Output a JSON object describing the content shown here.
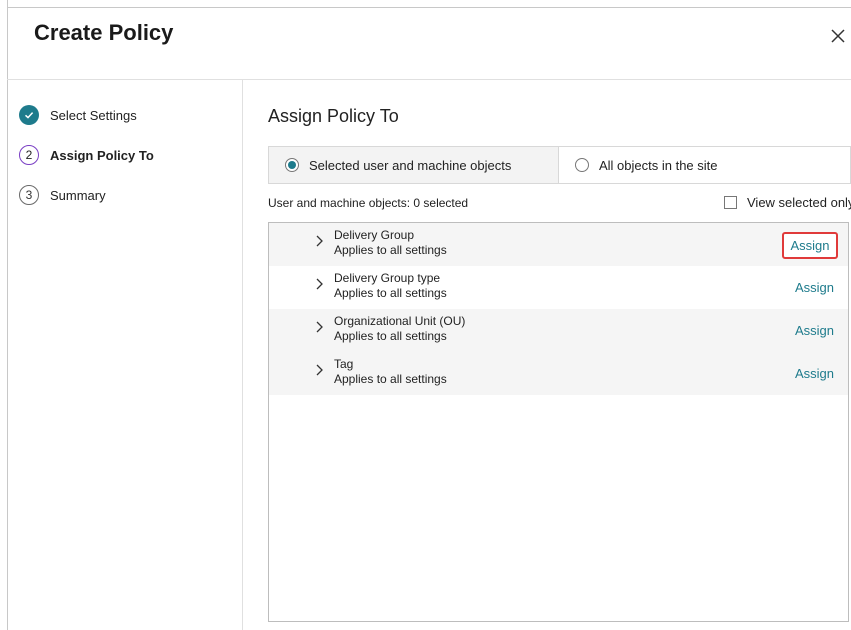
{
  "dialog": {
    "title": "Create Policy",
    "close_icon": "close-icon"
  },
  "steps": [
    {
      "number": "",
      "label": "Select Settings",
      "state": "completed",
      "icon": "check-icon"
    },
    {
      "number": "2",
      "label": "Assign Policy To",
      "state": "current"
    },
    {
      "number": "3",
      "label": "Summary",
      "state": "pending"
    }
  ],
  "main": {
    "title": "Assign Policy To",
    "radio_options": [
      {
        "label": "Selected user and machine objects",
        "selected": true
      },
      {
        "label": "All objects in the site",
        "selected": false
      }
    ],
    "objects_count_label": "User and machine objects: 0 selected",
    "view_selected_label": "View selected only",
    "view_selected_checked": false,
    "rows": [
      {
        "name": "Delivery Group",
        "subtitle": "Applies to all settings",
        "action": "Assign",
        "highlighted": true
      },
      {
        "name": "Delivery Group type",
        "subtitle": "Applies to all settings",
        "action": "Assign",
        "highlighted": false
      },
      {
        "name": "Organizational Unit (OU)",
        "subtitle": "Applies to all settings",
        "action": "Assign",
        "highlighted": false
      },
      {
        "name": "Tag",
        "subtitle": "Applies to all settings",
        "action": "Assign",
        "highlighted": false
      }
    ]
  },
  "colors": {
    "accent": "#1e7b8c",
    "current_step": "#7a3fc4",
    "highlight": "#e03a3a"
  }
}
